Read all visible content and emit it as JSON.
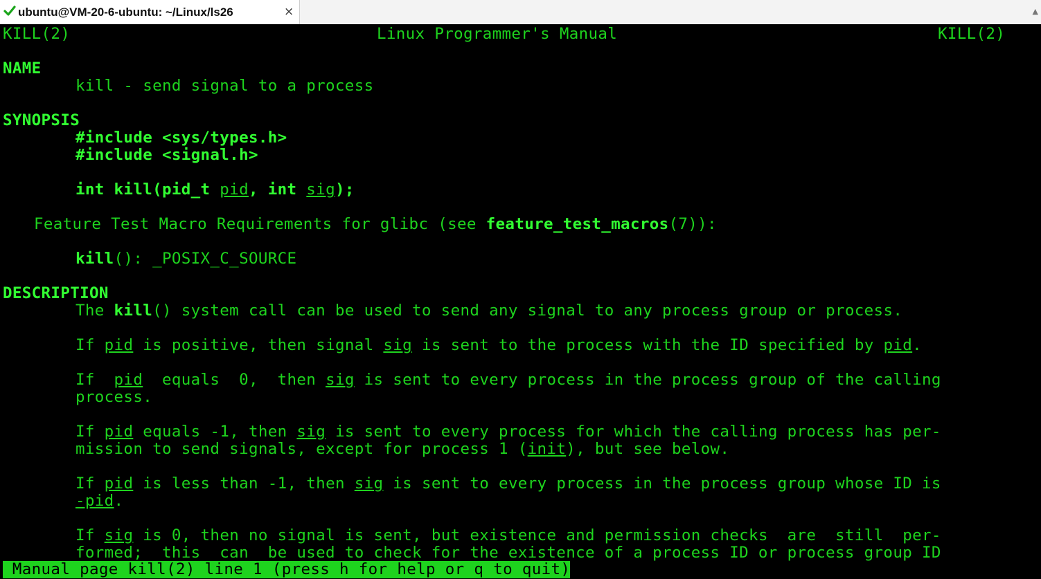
{
  "window": {
    "tab_title": "ubuntu@VM-20-6-ubuntu: ~/Linux/ls26",
    "close_glyph": "×",
    "scroll_glyph": "▲",
    "check_color": "#1aa51a"
  },
  "man": {
    "header_left": "KILL(2)",
    "header_center": "Linux Programmer's Manual",
    "header_right": "KILL(2)",
    "sections": {
      "name": "NAME",
      "synopsis": "SYNOPSIS",
      "description": "DESCRIPTION"
    },
    "name_line": "kill - send signal to a process",
    "synopsis": {
      "include1": "#include <sys/types.h>",
      "include2": "#include <signal.h>",
      "proto_pre": "int kill(pid_t ",
      "proto_arg1": "pid",
      "proto_mid": ", int ",
      "proto_arg2": "sig",
      "proto_post": ");",
      "ftm_pre": "Feature Test Macro Requirements for glibc (see ",
      "ftm_ref": "feature_test_macros",
      "ftm_post": "(7)):",
      "kill_fn": "kill",
      "kill_rest": "(): _POSIX_C_SOURCE"
    },
    "desc": {
      "p1_a": "The ",
      "p1_b": "kill",
      "p1_c": "() system call can be used to send any signal to any process group or process.",
      "p2_a": "If ",
      "p2_pid": "pid",
      "p2_b": " is positive, then signal ",
      "p2_sig": "sig",
      "p2_c": " is sent to the process with the ID specified by ",
      "p2_pid2": "pid",
      "p2_d": ".",
      "p3_a": "If  ",
      "p3_pid": "pid",
      "p3_b": "  equals  0,  then ",
      "p3_sig": "sig",
      "p3_c": " is sent to every process in the process group of the calling",
      "p3_l2": "process.",
      "p4_a": "If ",
      "p4_pid": "pid",
      "p4_b": " equals -1, then ",
      "p4_sig": "sig",
      "p4_c": " is sent to every process for which the calling process has per‐",
      "p4_l2a": "mission to send signals, except for process 1 (",
      "p4_init": "init",
      "p4_l2b": "), but see below.",
      "p5_a": "If ",
      "p5_pid": "pid",
      "p5_b": " is less than -1, then ",
      "p5_sig": "sig",
      "p5_c": " is sent to every process in the process group whose ID is",
      "p5_neg": "-pid",
      "p5_dot": ".",
      "p6_a": "If ",
      "p6_sig": "sig",
      "p6_b": " is 0, then no signal is sent, but existence and permission checks  are  still  per‐",
      "p6_l2": "formed;  this  can  be used to check for the existence of a process ID or process group ID"
    },
    "status_bar": " Manual page kill(2) line 1 (press h for help or q to quit)"
  },
  "colors": {
    "terminal_bg": "#000000",
    "text_green": "#1ed31e",
    "bold_green": "#32ff32",
    "status_bg": "#1ed31e"
  }
}
